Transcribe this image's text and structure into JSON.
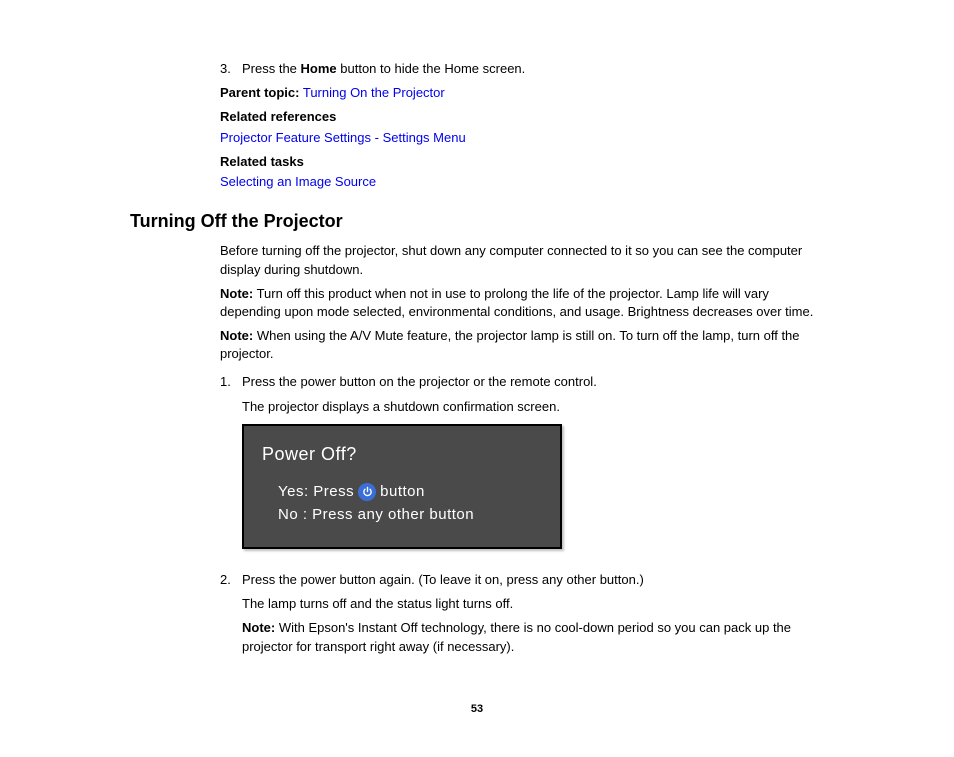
{
  "top": {
    "step3_num": "3.",
    "step3_pre": "Press the ",
    "step3_bold": "Home",
    "step3_post": " button to hide the Home screen.",
    "parent_label": "Parent topic:",
    "parent_link": "Turning On the Projector",
    "related_ref_label": "Related references",
    "related_ref_link": "Projector Feature Settings - Settings Menu",
    "related_tasks_label": "Related tasks",
    "related_tasks_link": "Selecting an Image Source"
  },
  "section": {
    "heading": "Turning Off the Projector",
    "intro": "Before turning off the projector, shut down any computer connected to it so you can see the computer display during shutdown.",
    "note1_label": "Note:",
    "note1_text": " Turn off this product when not in use to prolong the life of the projector. Lamp life will vary depending upon mode selected, environmental conditions, and usage. Brightness decreases over time.",
    "note2_label": "Note:",
    "note2_text": " When using the A/V Mute feature, the projector lamp is still on. To turn off the lamp, turn off the projector.",
    "step1_num": "1.",
    "step1_text": "Press the power button on the projector or the remote control.",
    "step1_sub": "The projector displays a shutdown confirmation screen.",
    "dialog": {
      "title": "Power Off?",
      "yes_pre": "Yes:  Press ",
      "yes_post": " button",
      "no": "No  :  Press any other button"
    },
    "step2_num": "2.",
    "step2_text": "Press the power button again. (To leave it on, press any other button.)",
    "step2_sub": "The lamp turns off and the status light turns off.",
    "note3_label": "Note:",
    "note3_text": " With Epson's Instant Off technology, there is no cool-down period so you can pack up the projector for transport right away (if necessary)."
  },
  "page_number": "53"
}
